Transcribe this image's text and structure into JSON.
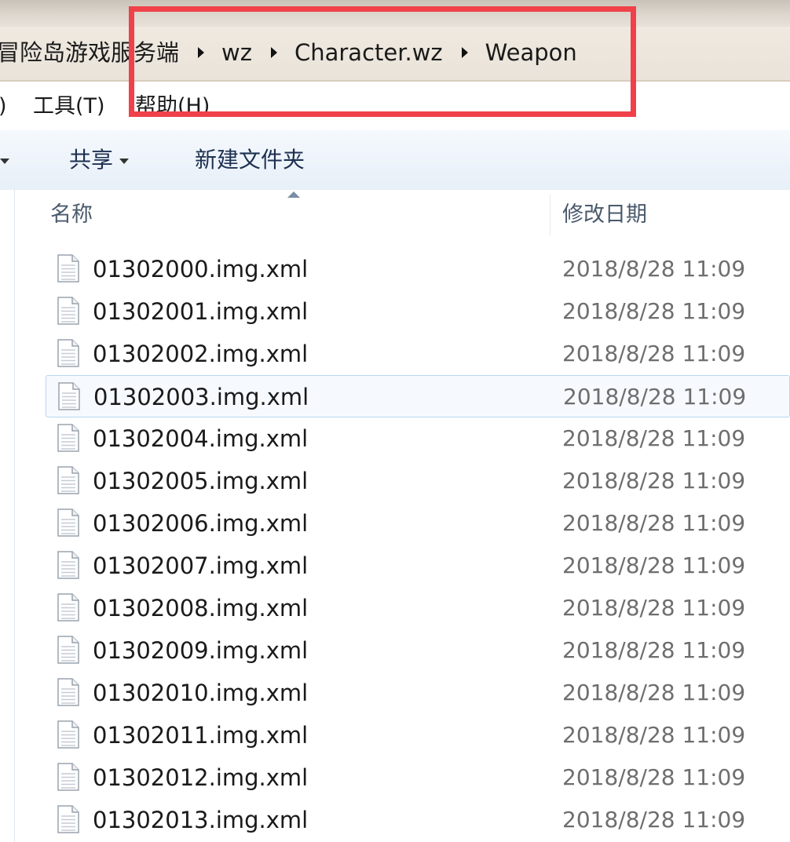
{
  "address_bar": {
    "crumbs": [
      "冒险岛游戏服务端",
      "wz",
      "Character.wz",
      "Weapon"
    ]
  },
  "menubar": {
    "items": [
      ")",
      "工具(T)",
      "帮助(H)"
    ]
  },
  "toolbar": {
    "share_label": "共享",
    "new_folder_label": "新建文件夹"
  },
  "file_list": {
    "columns": {
      "name": "名称",
      "modified": "修改日期"
    },
    "selected_index": 3,
    "files": [
      {
        "name": "01302000.img.xml",
        "modified": "2018/8/28 11:09"
      },
      {
        "name": "01302001.img.xml",
        "modified": "2018/8/28 11:09"
      },
      {
        "name": "01302002.img.xml",
        "modified": "2018/8/28 11:09"
      },
      {
        "name": "01302003.img.xml",
        "modified": "2018/8/28 11:09"
      },
      {
        "name": "01302004.img.xml",
        "modified": "2018/8/28 11:09"
      },
      {
        "name": "01302005.img.xml",
        "modified": "2018/8/28 11:09"
      },
      {
        "name": "01302006.img.xml",
        "modified": "2018/8/28 11:09"
      },
      {
        "name": "01302007.img.xml",
        "modified": "2018/8/28 11:09"
      },
      {
        "name": "01302008.img.xml",
        "modified": "2018/8/28 11:09"
      },
      {
        "name": "01302009.img.xml",
        "modified": "2018/8/28 11:09"
      },
      {
        "name": "01302010.img.xml",
        "modified": "2018/8/28 11:09"
      },
      {
        "name": "01302011.img.xml",
        "modified": "2018/8/28 11:09"
      },
      {
        "name": "01302012.img.xml",
        "modified": "2018/8/28 11:09"
      },
      {
        "name": "01302013.img.xml",
        "modified": "2018/8/28 11:09"
      }
    ]
  },
  "annotation": {
    "highlight_color": "#f0414a"
  },
  "icons": {
    "file": "document-icon",
    "breadcrumb_separator": "chevron-right-icon"
  }
}
